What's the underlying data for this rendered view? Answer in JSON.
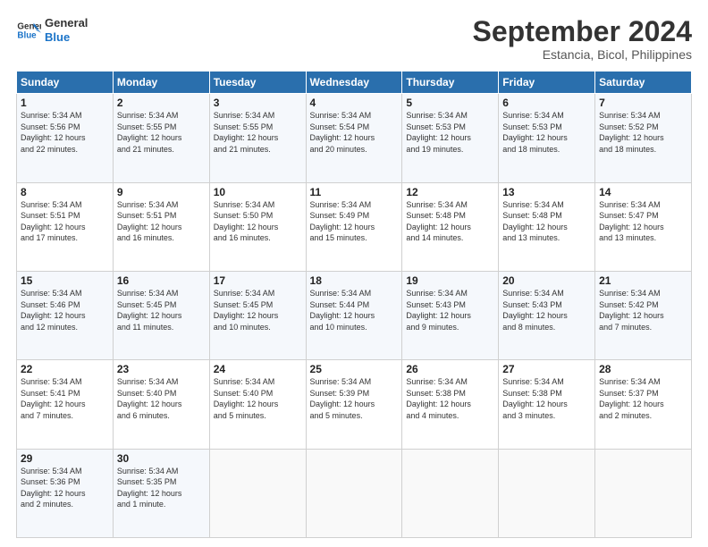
{
  "logo": {
    "line1": "General",
    "line2": "Blue"
  },
  "title": "September 2024",
  "subtitle": "Estancia, Bicol, Philippines",
  "weekdays": [
    "Sunday",
    "Monday",
    "Tuesday",
    "Wednesday",
    "Thursday",
    "Friday",
    "Saturday"
  ],
  "weeks": [
    [
      {
        "day": "1",
        "info": "Sunrise: 5:34 AM\nSunset: 5:56 PM\nDaylight: 12 hours\nand 22 minutes."
      },
      {
        "day": "2",
        "info": "Sunrise: 5:34 AM\nSunset: 5:55 PM\nDaylight: 12 hours\nand 21 minutes."
      },
      {
        "day": "3",
        "info": "Sunrise: 5:34 AM\nSunset: 5:55 PM\nDaylight: 12 hours\nand 21 minutes."
      },
      {
        "day": "4",
        "info": "Sunrise: 5:34 AM\nSunset: 5:54 PM\nDaylight: 12 hours\nand 20 minutes."
      },
      {
        "day": "5",
        "info": "Sunrise: 5:34 AM\nSunset: 5:53 PM\nDaylight: 12 hours\nand 19 minutes."
      },
      {
        "day": "6",
        "info": "Sunrise: 5:34 AM\nSunset: 5:53 PM\nDaylight: 12 hours\nand 18 minutes."
      },
      {
        "day": "7",
        "info": "Sunrise: 5:34 AM\nSunset: 5:52 PM\nDaylight: 12 hours\nand 18 minutes."
      }
    ],
    [
      {
        "day": "8",
        "info": "Sunrise: 5:34 AM\nSunset: 5:51 PM\nDaylight: 12 hours\nand 17 minutes."
      },
      {
        "day": "9",
        "info": "Sunrise: 5:34 AM\nSunset: 5:51 PM\nDaylight: 12 hours\nand 16 minutes."
      },
      {
        "day": "10",
        "info": "Sunrise: 5:34 AM\nSunset: 5:50 PM\nDaylight: 12 hours\nand 16 minutes."
      },
      {
        "day": "11",
        "info": "Sunrise: 5:34 AM\nSunset: 5:49 PM\nDaylight: 12 hours\nand 15 minutes."
      },
      {
        "day": "12",
        "info": "Sunrise: 5:34 AM\nSunset: 5:48 PM\nDaylight: 12 hours\nand 14 minutes."
      },
      {
        "day": "13",
        "info": "Sunrise: 5:34 AM\nSunset: 5:48 PM\nDaylight: 12 hours\nand 13 minutes."
      },
      {
        "day": "14",
        "info": "Sunrise: 5:34 AM\nSunset: 5:47 PM\nDaylight: 12 hours\nand 13 minutes."
      }
    ],
    [
      {
        "day": "15",
        "info": "Sunrise: 5:34 AM\nSunset: 5:46 PM\nDaylight: 12 hours\nand 12 minutes."
      },
      {
        "day": "16",
        "info": "Sunrise: 5:34 AM\nSunset: 5:45 PM\nDaylight: 12 hours\nand 11 minutes."
      },
      {
        "day": "17",
        "info": "Sunrise: 5:34 AM\nSunset: 5:45 PM\nDaylight: 12 hours\nand 10 minutes."
      },
      {
        "day": "18",
        "info": "Sunrise: 5:34 AM\nSunset: 5:44 PM\nDaylight: 12 hours\nand 10 minutes."
      },
      {
        "day": "19",
        "info": "Sunrise: 5:34 AM\nSunset: 5:43 PM\nDaylight: 12 hours\nand 9 minutes."
      },
      {
        "day": "20",
        "info": "Sunrise: 5:34 AM\nSunset: 5:43 PM\nDaylight: 12 hours\nand 8 minutes."
      },
      {
        "day": "21",
        "info": "Sunrise: 5:34 AM\nSunset: 5:42 PM\nDaylight: 12 hours\nand 7 minutes."
      }
    ],
    [
      {
        "day": "22",
        "info": "Sunrise: 5:34 AM\nSunset: 5:41 PM\nDaylight: 12 hours\nand 7 minutes."
      },
      {
        "day": "23",
        "info": "Sunrise: 5:34 AM\nSunset: 5:40 PM\nDaylight: 12 hours\nand 6 minutes."
      },
      {
        "day": "24",
        "info": "Sunrise: 5:34 AM\nSunset: 5:40 PM\nDaylight: 12 hours\nand 5 minutes."
      },
      {
        "day": "25",
        "info": "Sunrise: 5:34 AM\nSunset: 5:39 PM\nDaylight: 12 hours\nand 5 minutes."
      },
      {
        "day": "26",
        "info": "Sunrise: 5:34 AM\nSunset: 5:38 PM\nDaylight: 12 hours\nand 4 minutes."
      },
      {
        "day": "27",
        "info": "Sunrise: 5:34 AM\nSunset: 5:38 PM\nDaylight: 12 hours\nand 3 minutes."
      },
      {
        "day": "28",
        "info": "Sunrise: 5:34 AM\nSunset: 5:37 PM\nDaylight: 12 hours\nand 2 minutes."
      }
    ],
    [
      {
        "day": "29",
        "info": "Sunrise: 5:34 AM\nSunset: 5:36 PM\nDaylight: 12 hours\nand 2 minutes."
      },
      {
        "day": "30",
        "info": "Sunrise: 5:34 AM\nSunset: 5:35 PM\nDaylight: 12 hours\nand 1 minute."
      },
      {
        "day": "",
        "info": ""
      },
      {
        "day": "",
        "info": ""
      },
      {
        "day": "",
        "info": ""
      },
      {
        "day": "",
        "info": ""
      },
      {
        "day": "",
        "info": ""
      }
    ]
  ]
}
